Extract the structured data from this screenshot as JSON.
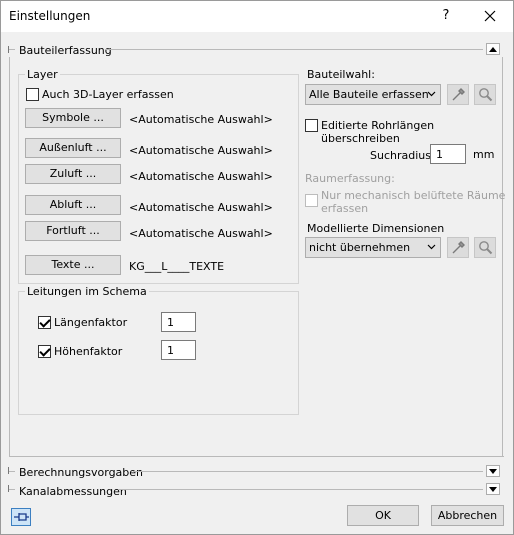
{
  "window": {
    "title": "Einstellungen",
    "help": "?"
  },
  "sections": {
    "bauteilerfassung": "Bauteilerfassung",
    "berechnungsvorgaben": "Berechnungsvorgaben",
    "kanalabmessungen": "Kanalabmessungen"
  },
  "layer": {
    "group_title": "Layer",
    "include_3d_label": "Auch 3D-Layer erfassen",
    "include_3d_checked": false,
    "rows": [
      {
        "button": "Symbole ...",
        "value": "<Automatische Auswahl>"
      },
      {
        "button": "Außenluft ...",
        "value": "<Automatische Auswahl>"
      },
      {
        "button": "Zuluft ...",
        "value": "<Automatische Auswahl>"
      },
      {
        "button": "Abluft ...",
        "value": "<Automatische Auswahl>"
      },
      {
        "button": "Fortluft ...",
        "value": "<Automatische Auswahl>"
      },
      {
        "button": "Texte ...",
        "value": "KG___L____TEXTE"
      }
    ]
  },
  "schema": {
    "group_title": "Leitungen im Schema",
    "laengenfaktor_label": "Längenfaktor",
    "laengenfaktor_checked": true,
    "laengenfaktor_value": "1",
    "hoehenfaktor_label": "Höhenfaktor",
    "hoehenfaktor_checked": true,
    "hoehenfaktor_value": "1"
  },
  "right": {
    "bauteilwahl_label": "Bauteilwahl:",
    "bauteilwahl_value": "Alle Bauteile erfassen",
    "edit_pipe_label": "Editierte Rohrlängen überschreiben",
    "edit_pipe_checked": false,
    "suchradius_label": "Suchradius:",
    "suchradius_value": "1",
    "suchradius_unit": "mm",
    "raumerfassung_label": "Raumerfassung:",
    "raum_line1": "Nur mechanisch belüftete Räume",
    "raum_line2": "erfassen",
    "dimensionen_label": "Modellierte Dimensionen",
    "dimensionen_value": "nicht übernehmen"
  },
  "footer": {
    "ok": "OK",
    "cancel": "Abbrechen"
  },
  "icons": {
    "picker": "eyedropper-icon",
    "search": "magnifier-icon",
    "pin": "pin-icon"
  }
}
